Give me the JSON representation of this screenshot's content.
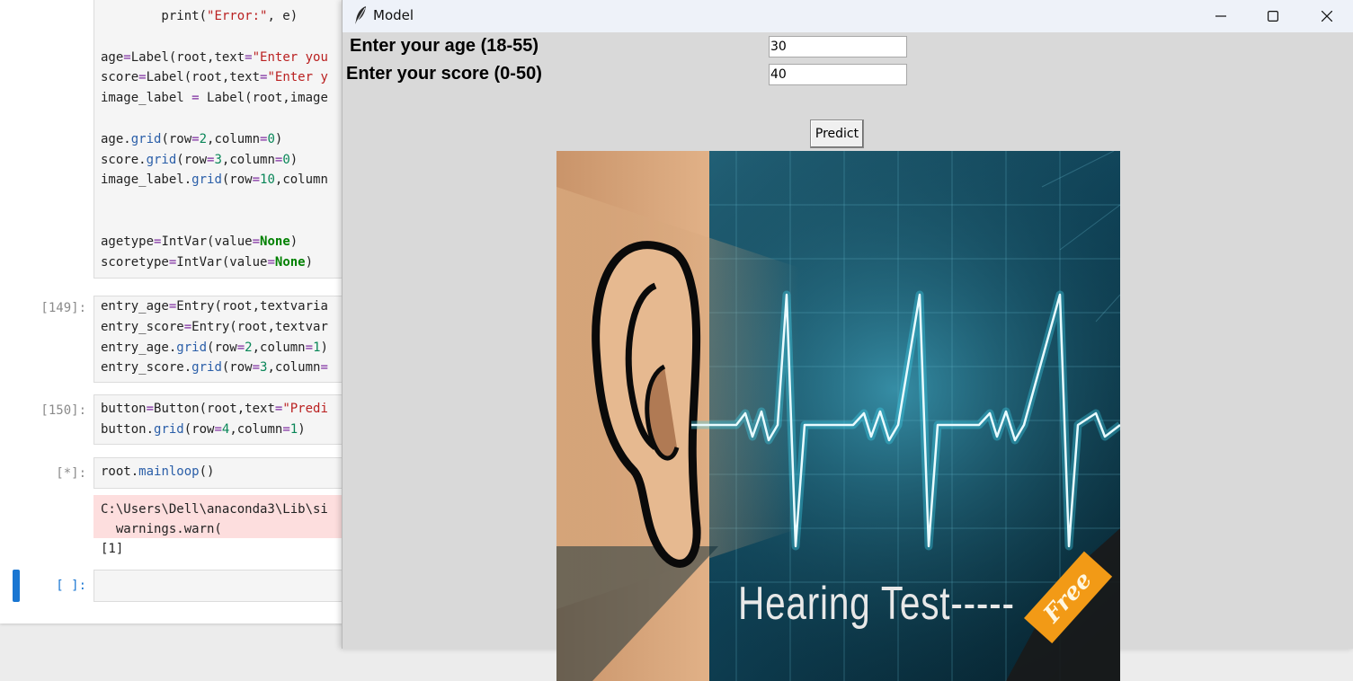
{
  "notebook": {
    "cells": [
      {
        "prompt": "",
        "lines": [
          [
            {
              "t": "        print(",
              "c": ""
            },
            {
              "t": "\"Error:\"",
              "c": "str"
            },
            {
              "t": ", e)",
              "c": ""
            }
          ],
          [],
          [
            {
              "t": "age",
              "c": ""
            },
            {
              "t": "=",
              "c": "kw"
            },
            {
              "t": "Label(root,text",
              "c": ""
            },
            {
              "t": "=",
              "c": "kw"
            },
            {
              "t": "\"Enter you",
              "c": "str"
            }
          ],
          [
            {
              "t": "score",
              "c": ""
            },
            {
              "t": "=",
              "c": "kw"
            },
            {
              "t": "Label(root,text",
              "c": ""
            },
            {
              "t": "=",
              "c": "kw"
            },
            {
              "t": "\"Enter y",
              "c": "str"
            }
          ],
          [
            {
              "t": "image_label ",
              "c": ""
            },
            {
              "t": "=",
              "c": "kw"
            },
            {
              "t": " Label(root,image",
              "c": ""
            }
          ],
          [],
          [
            {
              "t": "age.",
              "c": ""
            },
            {
              "t": "grid",
              "c": "fn"
            },
            {
              "t": "(row",
              "c": ""
            },
            {
              "t": "=",
              "c": "kw"
            },
            {
              "t": "2",
              "c": "num"
            },
            {
              "t": ",column",
              "c": ""
            },
            {
              "t": "=",
              "c": "kw"
            },
            {
              "t": "0",
              "c": "num"
            },
            {
              "t": ")",
              "c": ""
            }
          ],
          [
            {
              "t": "score.",
              "c": ""
            },
            {
              "t": "grid",
              "c": "fn"
            },
            {
              "t": "(row",
              "c": ""
            },
            {
              "t": "=",
              "c": "kw"
            },
            {
              "t": "3",
              "c": "num"
            },
            {
              "t": ",column",
              "c": ""
            },
            {
              "t": "=",
              "c": "kw"
            },
            {
              "t": "0",
              "c": "num"
            },
            {
              "t": ")",
              "c": ""
            }
          ],
          [
            {
              "t": "image_label.",
              "c": ""
            },
            {
              "t": "grid",
              "c": "fn"
            },
            {
              "t": "(row",
              "c": ""
            },
            {
              "t": "=",
              "c": "kw"
            },
            {
              "t": "10",
              "c": "num"
            },
            {
              "t": ",column",
              "c": ""
            }
          ],
          [],
          [],
          [
            {
              "t": "agetype",
              "c": ""
            },
            {
              "t": "=",
              "c": "kw"
            },
            {
              "t": "IntVar(value",
              "c": ""
            },
            {
              "t": "=",
              "c": "kw"
            },
            {
              "t": "None",
              "c": "bold"
            },
            {
              "t": ")",
              "c": ""
            }
          ],
          [
            {
              "t": "scoretype",
              "c": ""
            },
            {
              "t": "=",
              "c": "kw"
            },
            {
              "t": "IntVar(value",
              "c": ""
            },
            {
              "t": "=",
              "c": "kw"
            },
            {
              "t": "None",
              "c": "bold"
            },
            {
              "t": ")",
              "c": ""
            }
          ]
        ]
      },
      {
        "prompt": "[149]:",
        "lines": [
          [
            {
              "t": "entry_age",
              "c": ""
            },
            {
              "t": "=",
              "c": "kw"
            },
            {
              "t": "Entry(root,textvaria",
              "c": ""
            }
          ],
          [
            {
              "t": "entry_score",
              "c": ""
            },
            {
              "t": "=",
              "c": "kw"
            },
            {
              "t": "Entry(root,textvar",
              "c": ""
            }
          ],
          [
            {
              "t": "entry_age.",
              "c": ""
            },
            {
              "t": "grid",
              "c": "fn"
            },
            {
              "t": "(row",
              "c": ""
            },
            {
              "t": "=",
              "c": "kw"
            },
            {
              "t": "2",
              "c": "num"
            },
            {
              "t": ",column",
              "c": ""
            },
            {
              "t": "=",
              "c": "kw"
            },
            {
              "t": "1",
              "c": "num"
            },
            {
              "t": ")",
              "c": ""
            }
          ],
          [
            {
              "t": "entry_score.",
              "c": ""
            },
            {
              "t": "grid",
              "c": "fn"
            },
            {
              "t": "(row",
              "c": ""
            },
            {
              "t": "=",
              "c": "kw"
            },
            {
              "t": "3",
              "c": "num"
            },
            {
              "t": ",column",
              "c": ""
            },
            {
              "t": "=",
              "c": "kw"
            }
          ]
        ]
      },
      {
        "prompt": "[150]:",
        "lines": [
          [
            {
              "t": "button",
              "c": ""
            },
            {
              "t": "=",
              "c": "kw"
            },
            {
              "t": "Button(root,text",
              "c": ""
            },
            {
              "t": "=",
              "c": "kw"
            },
            {
              "t": "\"Predi",
              "c": "str"
            }
          ],
          [
            {
              "t": "button.",
              "c": ""
            },
            {
              "t": "grid",
              "c": "fn"
            },
            {
              "t": "(row",
              "c": ""
            },
            {
              "t": "=",
              "c": "kw"
            },
            {
              "t": "4",
              "c": "num"
            },
            {
              "t": ",column",
              "c": ""
            },
            {
              "t": "=",
              "c": "kw"
            },
            {
              "t": "1",
              "c": "num"
            },
            {
              "t": ")",
              "c": ""
            }
          ]
        ]
      },
      {
        "prompt": "[*]:",
        "lines": [
          [
            {
              "t": "root.",
              "c": ""
            },
            {
              "t": "mainloop",
              "c": "fn"
            },
            {
              "t": "()",
              "c": ""
            }
          ]
        ]
      },
      {
        "prompt": "[ ]:",
        "lines": []
      }
    ],
    "stderr_lines": [
      "C:\\Users\\Dell\\anaconda3\\Lib\\si",
      "  warnings.warn("
    ],
    "result": "[1]"
  },
  "window": {
    "title": "Model",
    "icon": "feather-icon",
    "controls": [
      "minimize-icon",
      "maximize-icon",
      "close-icon"
    ]
  },
  "form": {
    "age_label": "Enter your age (18-55)",
    "score_label": "Enter your score (0-50)",
    "age_value": "30",
    "score_value": "40",
    "predict_label": "Predict"
  },
  "image": {
    "caption": "Hearing Test-----",
    "badge": "Free"
  },
  "colors": {
    "accent": "#1976d2",
    "tk_bg": "#d9d9d9",
    "ecg_glow": "#3fd8f0",
    "badge": "#f29a16"
  }
}
